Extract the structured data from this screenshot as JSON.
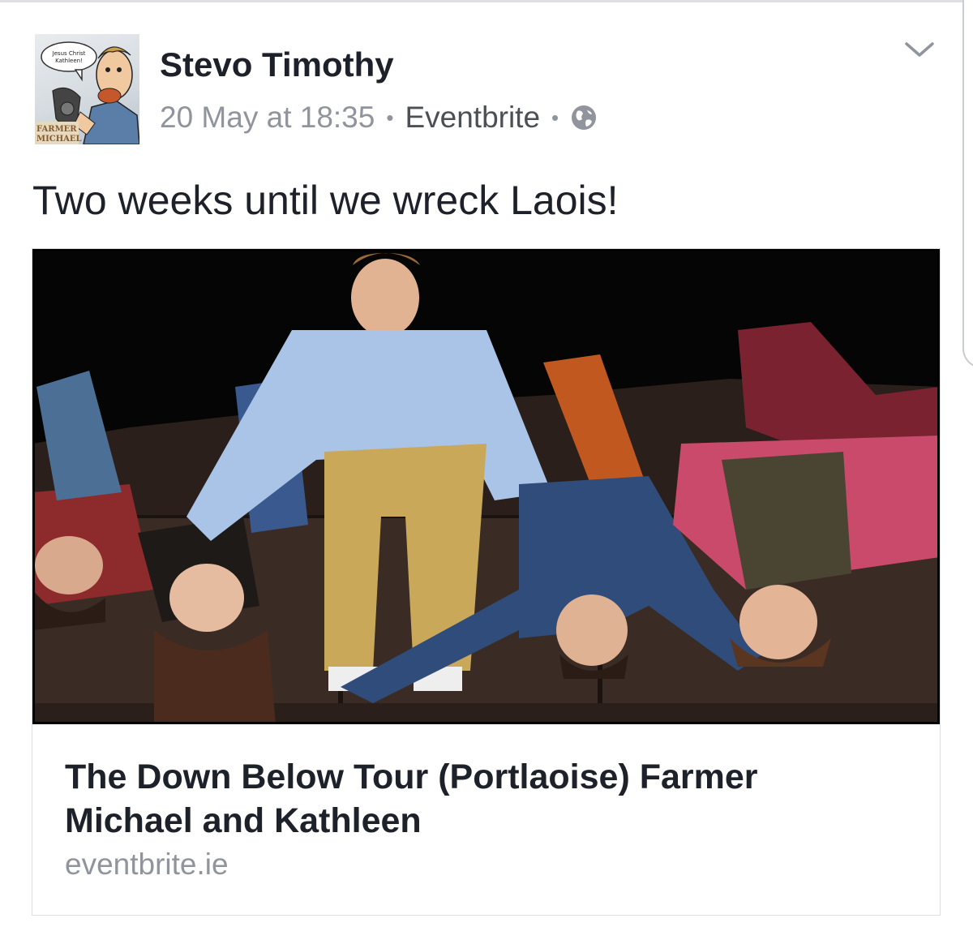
{
  "post": {
    "author": "Stevo Timothy",
    "timestamp": "20 May at 18:35",
    "separator": "•",
    "source": "Eventbrite",
    "privacy_icon": "globe-icon",
    "menu_icon": "chevron-down-icon",
    "text": "Two weeks until we wreck Laois!"
  },
  "avatar": {
    "caption": "Farmer Michael",
    "speech": "Jesus Christ Kathleen!"
  },
  "link": {
    "title": "The Down Below Tour (Portlaoise) Farmer Michael and Kathleen",
    "domain": "eventbrite.ie"
  },
  "colors": {
    "name_text": "#1d2129",
    "meta_text": "#90949c",
    "source_text": "#4b4f56",
    "border": "#dddfe2"
  }
}
